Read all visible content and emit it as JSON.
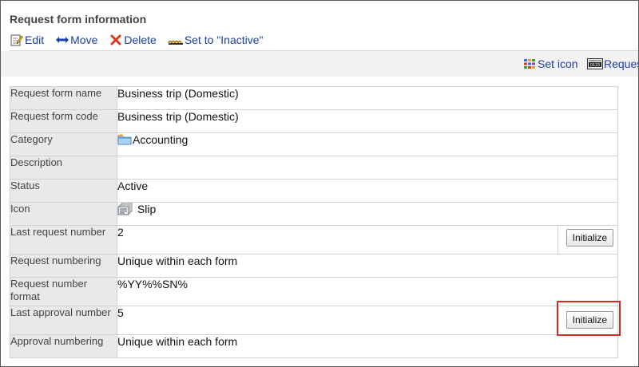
{
  "page": {
    "title": "Request form information"
  },
  "toolbar": {
    "items": [
      {
        "label": "Edit",
        "icon": "edit-icon"
      },
      {
        "label": "Move",
        "icon": "move-arrows-icon"
      },
      {
        "label": "Delete",
        "icon": "delete-x-icon"
      },
      {
        "label": "Set to \"Inactive\"",
        "icon": "inactive-icon"
      }
    ]
  },
  "subtoolbar": {
    "items": [
      {
        "label": "Set icon",
        "icon": "grid-icon"
      },
      {
        "label": "Reques",
        "icon": "number-counter-icon"
      }
    ]
  },
  "form": {
    "rows": [
      {
        "label": "Request form name",
        "value": "Business trip (Domestic)"
      },
      {
        "label": "Request form code",
        "value": "Business trip (Domestic)"
      },
      {
        "label": "Category",
        "value": "Accounting",
        "icon": "folder-icon"
      },
      {
        "label": "Description",
        "value": ""
      },
      {
        "label": "Status",
        "value": "Active",
        "color": "#1b7f12"
      },
      {
        "label": "Icon",
        "value": "Slip",
        "icon": "slip-icon"
      },
      {
        "label": "Last request number",
        "value": "2",
        "button": "Initialize"
      },
      {
        "label": "Request numbering",
        "value": "Unique within each form"
      },
      {
        "label": "Request number format",
        "value": "%YY%%SN%"
      },
      {
        "label": "Last approval number",
        "value": "5",
        "button": "Initialize"
      },
      {
        "label": "Approval numbering",
        "value": "Unique within each form"
      }
    ]
  },
  "colors": {
    "link": "#1a3fa8",
    "active": "#1b7f12",
    "highlight": "#d6281e"
  }
}
